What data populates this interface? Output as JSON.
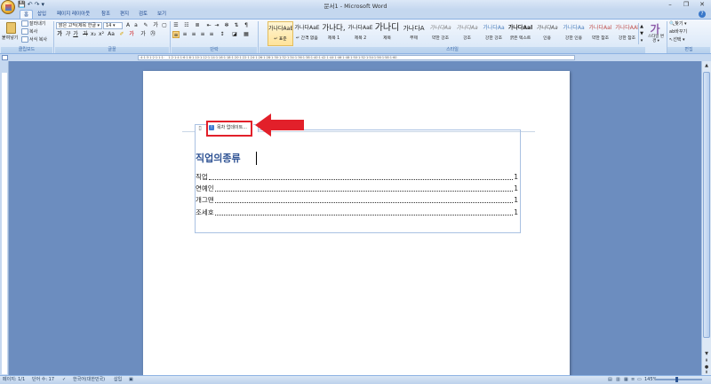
{
  "window": {
    "title": "문서1 - Microsoft Word"
  },
  "quick_access": {
    "save": "💾",
    "undo": "↶",
    "redo": "↷",
    "more": "▾"
  },
  "tabs": [
    "홈",
    "삽입",
    "페이지 레이아웃",
    "참조",
    "편지",
    "검토",
    "보기"
  ],
  "active_tab": "홈",
  "ribbon": {
    "clipboard": {
      "paste_label": "붙여넣기",
      "cut_label": "잘라내기",
      "copy_label": "복사",
      "format_painter_label": "서식 복사",
      "group_label": "클립보드"
    },
    "font": {
      "font_name": "맑은 고딕(제목 한글 ▾",
      "font_size": "14 ▾",
      "group_label": "글꼴",
      "buttons": [
        "가",
        "가",
        "가",
        "가",
        "가",
        "가"
      ]
    },
    "paragraph": {
      "group_label": "단락"
    },
    "styles": {
      "group_label": "스타일",
      "items": [
        {
          "preview": "가나다AaE",
          "name": "↵ 표준",
          "color": "#222222"
        },
        {
          "preview": "가나다AaE",
          "name": "↵ 간격 없음",
          "color": "#222222"
        },
        {
          "preview": "가나다,",
          "name": "제목 1",
          "color": "#222222"
        },
        {
          "preview": "가나다AaE",
          "name": "제목 2",
          "color": "#222222"
        },
        {
          "preview": "가나디",
          "name": "제목",
          "color": "#222222"
        },
        {
          "preview": "가나다A",
          "name": "부제",
          "color": "#222222"
        },
        {
          "preview": "가나다Aa",
          "name": "약한 강조",
          "color": "#7f7f7f"
        },
        {
          "preview": "가나다Aa",
          "name": "강조",
          "color": "#7f7f7f"
        },
        {
          "preview": "가나다Aa",
          "name": "강한 강조",
          "color": "#4f81bd"
        },
        {
          "preview": "가나다Aal",
          "name": "굵은 텍스트",
          "color": "#222222"
        },
        {
          "preview": "가나다Aa",
          "name": "인용",
          "color": "#555555"
        },
        {
          "preview": "가나다Aa",
          "name": "강한 인용",
          "color": "#4f81bd"
        },
        {
          "preview": "가나다Aal",
          "name": "약한 참조",
          "color": "#c0504d"
        },
        {
          "preview": "가나다AAl",
          "name": "강한 참조",
          "color": "#c0504d"
        }
      ],
      "change_styles_label": "스타일 변경 ▾"
    },
    "editing": {
      "find_label": "찾기 ▾",
      "replace_label": "바꾸기",
      "select_label": "선택 ▾",
      "group_label": "편집"
    }
  },
  "document": {
    "toc_update_button": "목차 업데이트...",
    "toc_heading": "직업의종류",
    "toc_entries": [
      {
        "title": "직업",
        "page": "1"
      },
      {
        "title": "연예인",
        "page": "1"
      },
      {
        "title": "개그맨",
        "page": "1"
      },
      {
        "title": "조세호",
        "page": "1"
      }
    ]
  },
  "statusbar": {
    "page": "페이지: 1/1",
    "words": "단어 수: 17",
    "language": "한국어(대한민국)",
    "mode": "삽입",
    "zoom": "145%"
  },
  "colors": {
    "highlight_box": "#e2202a",
    "arrow": "#e2202a",
    "heading": "#2f5394"
  }
}
